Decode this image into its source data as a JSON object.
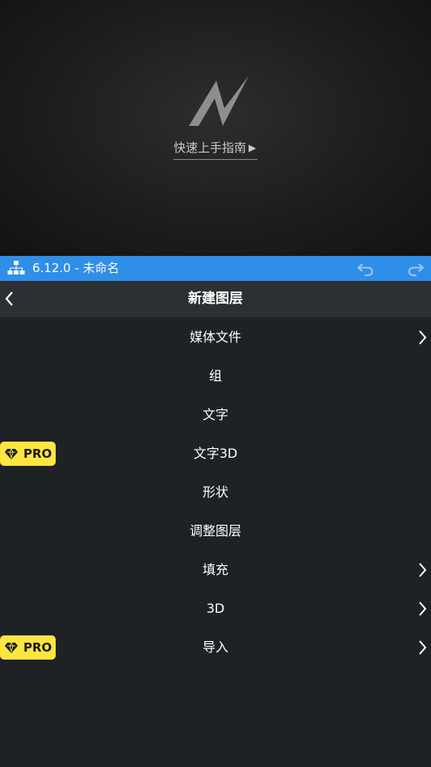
{
  "preview": {
    "guide_label": "快速上手指南",
    "play_glyph": "▶"
  },
  "titlebar": {
    "title": "6.12.0 - 未命名",
    "color": "#2f8ee8"
  },
  "header": {
    "title": "新建图层"
  },
  "menu": {
    "items": [
      {
        "label": "媒体文件",
        "submenu": true,
        "pro": false
      },
      {
        "label": "组",
        "submenu": false,
        "pro": false
      },
      {
        "label": "文字",
        "submenu": false,
        "pro": false
      },
      {
        "label": "文字3D",
        "submenu": false,
        "pro": true
      },
      {
        "label": "形状",
        "submenu": false,
        "pro": false
      },
      {
        "label": "调整图层",
        "submenu": false,
        "pro": false
      },
      {
        "label": "填充",
        "submenu": true,
        "pro": false
      },
      {
        "label": "3D",
        "submenu": true,
        "pro": false
      },
      {
        "label": "导入",
        "submenu": true,
        "pro": true
      }
    ],
    "pro_badge_label": "PRO",
    "pro_badge_color": "#fde640"
  }
}
